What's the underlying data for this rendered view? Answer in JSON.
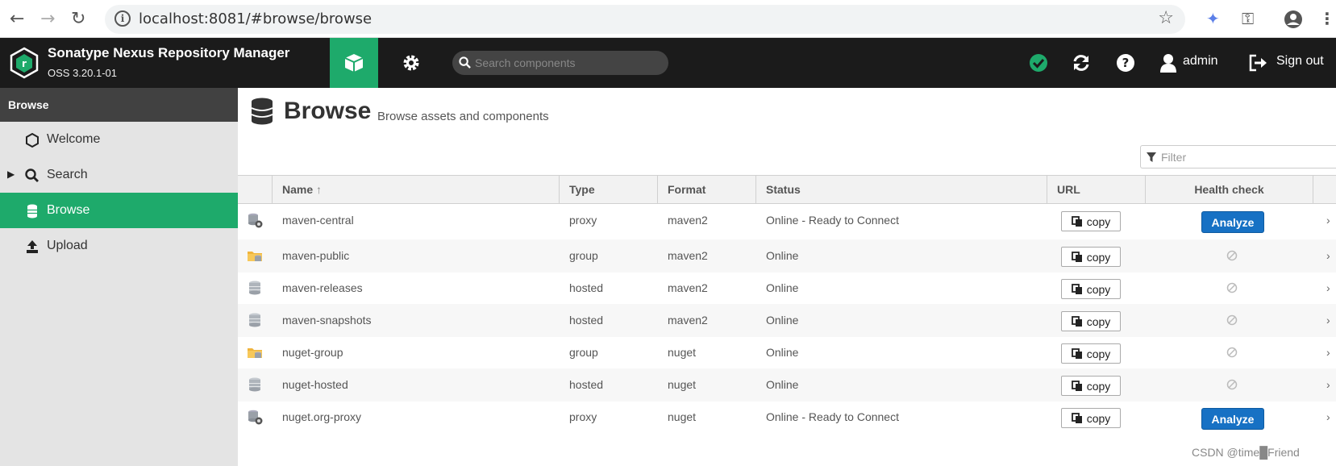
{
  "browser": {
    "url": "localhost:8081/#browse/browse"
  },
  "app": {
    "title": "Sonatype Nexus Repository Manager",
    "version": "OSS 3.20.1-01",
    "search_placeholder": "Search components",
    "user": "admin",
    "signout": "Sign out",
    "accent": "#1eaa6b"
  },
  "sidebar": {
    "heading": "Browse",
    "items": [
      {
        "label": "Welcome",
        "icon": "hexagon-icon"
      },
      {
        "label": "Search",
        "icon": "search-icon"
      },
      {
        "label": "Browse",
        "icon": "database-icon"
      },
      {
        "label": "Upload",
        "icon": "upload-icon"
      }
    ]
  },
  "main": {
    "title": "Browse",
    "subtitle": "Browse assets and components",
    "filter_placeholder": "Filter",
    "columns": {
      "name": "Name",
      "type": "Type",
      "format": "Format",
      "status": "Status",
      "url": "URL",
      "health": "Health check"
    },
    "copy_label": "copy",
    "analyze_label": "Analyze",
    "rows": [
      {
        "name": "maven-central",
        "type": "proxy",
        "format": "maven2",
        "status": "Online - Ready to Connect"
      },
      {
        "name": "maven-public",
        "type": "group",
        "format": "maven2",
        "status": "Online"
      },
      {
        "name": "maven-releases",
        "type": "hosted",
        "format": "maven2",
        "status": "Online"
      },
      {
        "name": "maven-snapshots",
        "type": "hosted",
        "format": "maven2",
        "status": "Online"
      },
      {
        "name": "nuget-group",
        "type": "group",
        "format": "nuget",
        "status": "Online"
      },
      {
        "name": "nuget-hosted",
        "type": "hosted",
        "format": "nuget",
        "status": "Online"
      },
      {
        "name": "nuget.org-proxy",
        "type": "proxy",
        "format": "nuget",
        "status": "Online - Ready to Connect"
      }
    ]
  },
  "watermark": "CSDN @time█Friend"
}
